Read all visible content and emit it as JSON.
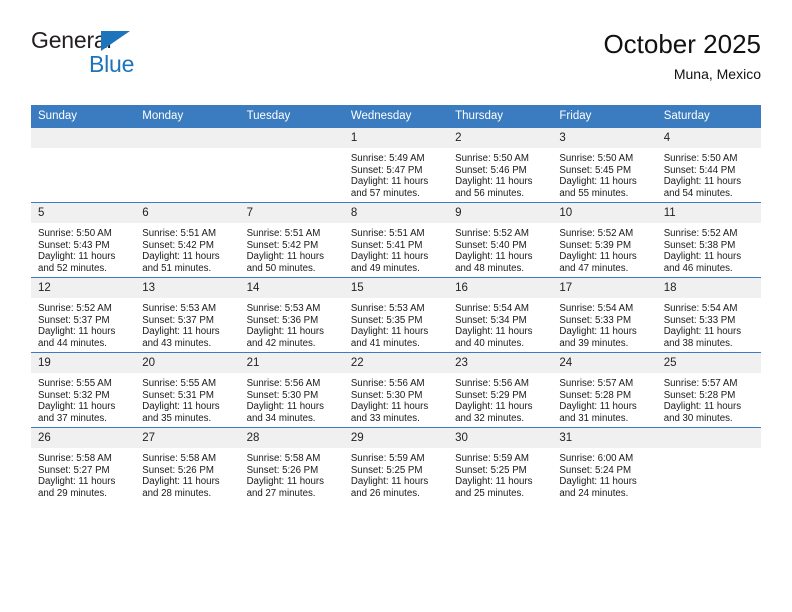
{
  "brand": {
    "line1": "General",
    "line2": "Blue",
    "triangle_color": "#1e74bb"
  },
  "header": {
    "title": "October 2025",
    "subtitle": "Muna, Mexico"
  },
  "theme": {
    "header_blue": "#3a7cbf",
    "daynum_band": "#f0f0f0",
    "text": "#1a1a1a"
  },
  "labels": {
    "sunrise_prefix": "Sunrise:",
    "sunset_prefix": "Sunset:",
    "daylight_prefix": "Daylight:"
  },
  "weekday_headers": [
    "Sunday",
    "Monday",
    "Tuesday",
    "Wednesday",
    "Thursday",
    "Friday",
    "Saturday"
  ],
  "weeks": [
    [
      {
        "day": "",
        "blank": true,
        "sunrise": "",
        "sunset": "",
        "daylight_l1": "",
        "daylight_l2": ""
      },
      {
        "day": "",
        "blank": true,
        "sunrise": "",
        "sunset": "",
        "daylight_l1": "",
        "daylight_l2": ""
      },
      {
        "day": "",
        "blank": true,
        "sunrise": "",
        "sunset": "",
        "daylight_l1": "",
        "daylight_l2": ""
      },
      {
        "day": "1",
        "blank": false,
        "sunrise": "Sunrise: 5:49 AM",
        "sunset": "Sunset: 5:47 PM",
        "daylight_l1": "Daylight: 11 hours",
        "daylight_l2": "and 57 minutes."
      },
      {
        "day": "2",
        "blank": false,
        "sunrise": "Sunrise: 5:50 AM",
        "sunset": "Sunset: 5:46 PM",
        "daylight_l1": "Daylight: 11 hours",
        "daylight_l2": "and 56 minutes."
      },
      {
        "day": "3",
        "blank": false,
        "sunrise": "Sunrise: 5:50 AM",
        "sunset": "Sunset: 5:45 PM",
        "daylight_l1": "Daylight: 11 hours",
        "daylight_l2": "and 55 minutes."
      },
      {
        "day": "4",
        "blank": false,
        "sunrise": "Sunrise: 5:50 AM",
        "sunset": "Sunset: 5:44 PM",
        "daylight_l1": "Daylight: 11 hours",
        "daylight_l2": "and 54 minutes."
      }
    ],
    [
      {
        "day": "5",
        "blank": false,
        "sunrise": "Sunrise: 5:50 AM",
        "sunset": "Sunset: 5:43 PM",
        "daylight_l1": "Daylight: 11 hours",
        "daylight_l2": "and 52 minutes."
      },
      {
        "day": "6",
        "blank": false,
        "sunrise": "Sunrise: 5:51 AM",
        "sunset": "Sunset: 5:42 PM",
        "daylight_l1": "Daylight: 11 hours",
        "daylight_l2": "and 51 minutes."
      },
      {
        "day": "7",
        "blank": false,
        "sunrise": "Sunrise: 5:51 AM",
        "sunset": "Sunset: 5:42 PM",
        "daylight_l1": "Daylight: 11 hours",
        "daylight_l2": "and 50 minutes."
      },
      {
        "day": "8",
        "blank": false,
        "sunrise": "Sunrise: 5:51 AM",
        "sunset": "Sunset: 5:41 PM",
        "daylight_l1": "Daylight: 11 hours",
        "daylight_l2": "and 49 minutes."
      },
      {
        "day": "9",
        "blank": false,
        "sunrise": "Sunrise: 5:52 AM",
        "sunset": "Sunset: 5:40 PM",
        "daylight_l1": "Daylight: 11 hours",
        "daylight_l2": "and 48 minutes."
      },
      {
        "day": "10",
        "blank": false,
        "sunrise": "Sunrise: 5:52 AM",
        "sunset": "Sunset: 5:39 PM",
        "daylight_l1": "Daylight: 11 hours",
        "daylight_l2": "and 47 minutes."
      },
      {
        "day": "11",
        "blank": false,
        "sunrise": "Sunrise: 5:52 AM",
        "sunset": "Sunset: 5:38 PM",
        "daylight_l1": "Daylight: 11 hours",
        "daylight_l2": "and 46 minutes."
      }
    ],
    [
      {
        "day": "12",
        "blank": false,
        "sunrise": "Sunrise: 5:52 AM",
        "sunset": "Sunset: 5:37 PM",
        "daylight_l1": "Daylight: 11 hours",
        "daylight_l2": "and 44 minutes."
      },
      {
        "day": "13",
        "blank": false,
        "sunrise": "Sunrise: 5:53 AM",
        "sunset": "Sunset: 5:37 PM",
        "daylight_l1": "Daylight: 11 hours",
        "daylight_l2": "and 43 minutes."
      },
      {
        "day": "14",
        "blank": false,
        "sunrise": "Sunrise: 5:53 AM",
        "sunset": "Sunset: 5:36 PM",
        "daylight_l1": "Daylight: 11 hours",
        "daylight_l2": "and 42 minutes."
      },
      {
        "day": "15",
        "blank": false,
        "sunrise": "Sunrise: 5:53 AM",
        "sunset": "Sunset: 5:35 PM",
        "daylight_l1": "Daylight: 11 hours",
        "daylight_l2": "and 41 minutes."
      },
      {
        "day": "16",
        "blank": false,
        "sunrise": "Sunrise: 5:54 AM",
        "sunset": "Sunset: 5:34 PM",
        "daylight_l1": "Daylight: 11 hours",
        "daylight_l2": "and 40 minutes."
      },
      {
        "day": "17",
        "blank": false,
        "sunrise": "Sunrise: 5:54 AM",
        "sunset": "Sunset: 5:33 PM",
        "daylight_l1": "Daylight: 11 hours",
        "daylight_l2": "and 39 minutes."
      },
      {
        "day": "18",
        "blank": false,
        "sunrise": "Sunrise: 5:54 AM",
        "sunset": "Sunset: 5:33 PM",
        "daylight_l1": "Daylight: 11 hours",
        "daylight_l2": "and 38 minutes."
      }
    ],
    [
      {
        "day": "19",
        "blank": false,
        "sunrise": "Sunrise: 5:55 AM",
        "sunset": "Sunset: 5:32 PM",
        "daylight_l1": "Daylight: 11 hours",
        "daylight_l2": "and 37 minutes."
      },
      {
        "day": "20",
        "blank": false,
        "sunrise": "Sunrise: 5:55 AM",
        "sunset": "Sunset: 5:31 PM",
        "daylight_l1": "Daylight: 11 hours",
        "daylight_l2": "and 35 minutes."
      },
      {
        "day": "21",
        "blank": false,
        "sunrise": "Sunrise: 5:56 AM",
        "sunset": "Sunset: 5:30 PM",
        "daylight_l1": "Daylight: 11 hours",
        "daylight_l2": "and 34 minutes."
      },
      {
        "day": "22",
        "blank": false,
        "sunrise": "Sunrise: 5:56 AM",
        "sunset": "Sunset: 5:30 PM",
        "daylight_l1": "Daylight: 11 hours",
        "daylight_l2": "and 33 minutes."
      },
      {
        "day": "23",
        "blank": false,
        "sunrise": "Sunrise: 5:56 AM",
        "sunset": "Sunset: 5:29 PM",
        "daylight_l1": "Daylight: 11 hours",
        "daylight_l2": "and 32 minutes."
      },
      {
        "day": "24",
        "blank": false,
        "sunrise": "Sunrise: 5:57 AM",
        "sunset": "Sunset: 5:28 PM",
        "daylight_l1": "Daylight: 11 hours",
        "daylight_l2": "and 31 minutes."
      },
      {
        "day": "25",
        "blank": false,
        "sunrise": "Sunrise: 5:57 AM",
        "sunset": "Sunset: 5:28 PM",
        "daylight_l1": "Daylight: 11 hours",
        "daylight_l2": "and 30 minutes."
      }
    ],
    [
      {
        "day": "26",
        "blank": false,
        "sunrise": "Sunrise: 5:58 AM",
        "sunset": "Sunset: 5:27 PM",
        "daylight_l1": "Daylight: 11 hours",
        "daylight_l2": "and 29 minutes."
      },
      {
        "day": "27",
        "blank": false,
        "sunrise": "Sunrise: 5:58 AM",
        "sunset": "Sunset: 5:26 PM",
        "daylight_l1": "Daylight: 11 hours",
        "daylight_l2": "and 28 minutes."
      },
      {
        "day": "28",
        "blank": false,
        "sunrise": "Sunrise: 5:58 AM",
        "sunset": "Sunset: 5:26 PM",
        "daylight_l1": "Daylight: 11 hours",
        "daylight_l2": "and 27 minutes."
      },
      {
        "day": "29",
        "blank": false,
        "sunrise": "Sunrise: 5:59 AM",
        "sunset": "Sunset: 5:25 PM",
        "daylight_l1": "Daylight: 11 hours",
        "daylight_l2": "and 26 minutes."
      },
      {
        "day": "30",
        "blank": false,
        "sunrise": "Sunrise: 5:59 AM",
        "sunset": "Sunset: 5:25 PM",
        "daylight_l1": "Daylight: 11 hours",
        "daylight_l2": "and 25 minutes."
      },
      {
        "day": "31",
        "blank": false,
        "sunrise": "Sunrise: 6:00 AM",
        "sunset": "Sunset: 5:24 PM",
        "daylight_l1": "Daylight: 11 hours",
        "daylight_l2": "and 24 minutes."
      },
      {
        "day": "",
        "blank": true,
        "sunrise": "",
        "sunset": "",
        "daylight_l1": "",
        "daylight_l2": ""
      }
    ]
  ]
}
